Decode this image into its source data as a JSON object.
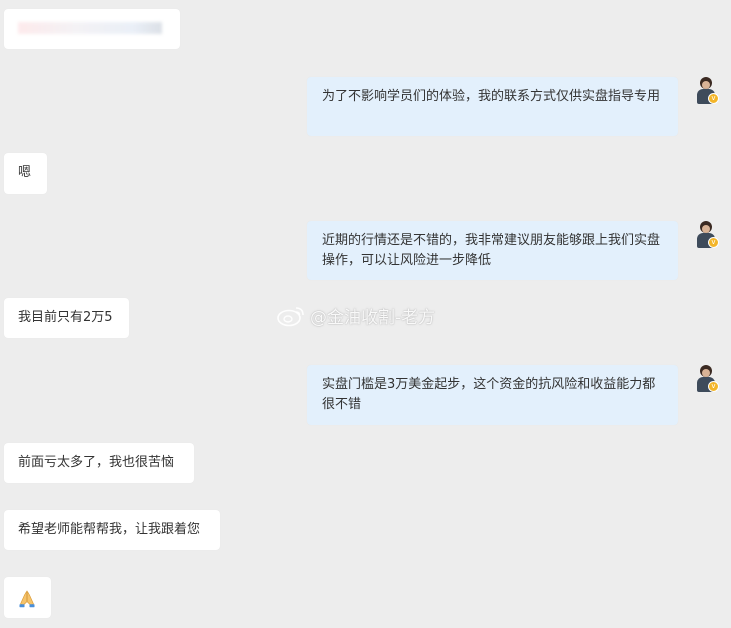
{
  "messages": [
    {
      "side": "right",
      "text": "为了不影响学员们的体验，我的联系方式仅供实盘指导专用"
    },
    {
      "side": "left",
      "text": "嗯"
    },
    {
      "side": "right",
      "text": "近期的行情还是不错的，我非常建议朋友能够跟上我们实盘操作，可以让风险进一步降低"
    },
    {
      "side": "left",
      "text": "我目前只有2万5"
    },
    {
      "side": "right",
      "text": "实盘门槛是3万美金起步，这个资金的抗风险和收益能力都很不错"
    },
    {
      "side": "left",
      "text": "前面亏太多了，我也很苦恼"
    },
    {
      "side": "left",
      "text": "希望老师能帮帮我，让我跟着您"
    },
    {
      "side": "left",
      "emoji": "folded-hands"
    }
  ],
  "watermark": {
    "text": "@金油收割-老方",
    "icon": "weibo-icon"
  },
  "colors": {
    "background": "#ededed",
    "left_bubble": "#ffffff",
    "right_bubble": "#e3f0fc",
    "badge": "#f3b529"
  }
}
